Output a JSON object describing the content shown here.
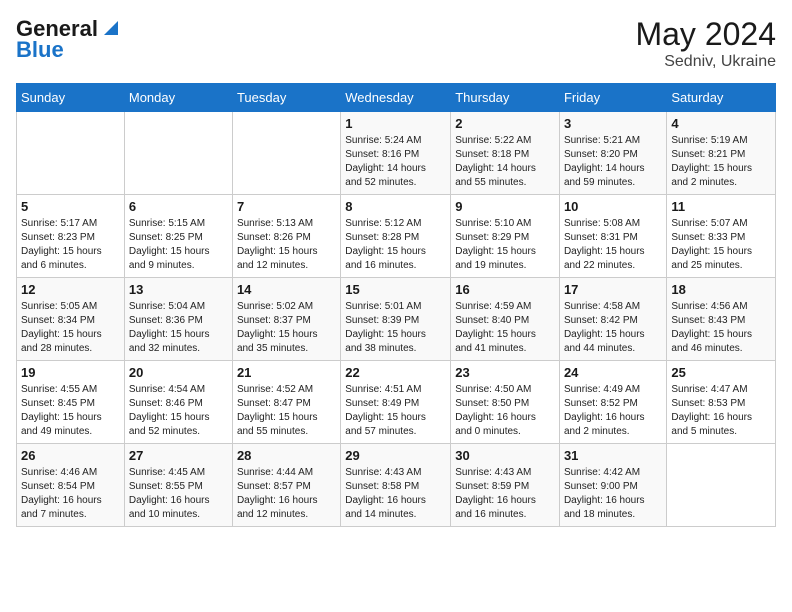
{
  "header": {
    "logo_line1": "General",
    "logo_line2": "Blue",
    "month_year": "May 2024",
    "location": "Sedniv, Ukraine"
  },
  "days_of_week": [
    "Sunday",
    "Monday",
    "Tuesday",
    "Wednesday",
    "Thursday",
    "Friday",
    "Saturday"
  ],
  "weeks": [
    [
      {
        "num": "",
        "info": ""
      },
      {
        "num": "",
        "info": ""
      },
      {
        "num": "",
        "info": ""
      },
      {
        "num": "1",
        "info": "Sunrise: 5:24 AM\nSunset: 8:16 PM\nDaylight: 14 hours\nand 52 minutes."
      },
      {
        "num": "2",
        "info": "Sunrise: 5:22 AM\nSunset: 8:18 PM\nDaylight: 14 hours\nand 55 minutes."
      },
      {
        "num": "3",
        "info": "Sunrise: 5:21 AM\nSunset: 8:20 PM\nDaylight: 14 hours\nand 59 minutes."
      },
      {
        "num": "4",
        "info": "Sunrise: 5:19 AM\nSunset: 8:21 PM\nDaylight: 15 hours\nand 2 minutes."
      }
    ],
    [
      {
        "num": "5",
        "info": "Sunrise: 5:17 AM\nSunset: 8:23 PM\nDaylight: 15 hours\nand 6 minutes."
      },
      {
        "num": "6",
        "info": "Sunrise: 5:15 AM\nSunset: 8:25 PM\nDaylight: 15 hours\nand 9 minutes."
      },
      {
        "num": "7",
        "info": "Sunrise: 5:13 AM\nSunset: 8:26 PM\nDaylight: 15 hours\nand 12 minutes."
      },
      {
        "num": "8",
        "info": "Sunrise: 5:12 AM\nSunset: 8:28 PM\nDaylight: 15 hours\nand 16 minutes."
      },
      {
        "num": "9",
        "info": "Sunrise: 5:10 AM\nSunset: 8:29 PM\nDaylight: 15 hours\nand 19 minutes."
      },
      {
        "num": "10",
        "info": "Sunrise: 5:08 AM\nSunset: 8:31 PM\nDaylight: 15 hours\nand 22 minutes."
      },
      {
        "num": "11",
        "info": "Sunrise: 5:07 AM\nSunset: 8:33 PM\nDaylight: 15 hours\nand 25 minutes."
      }
    ],
    [
      {
        "num": "12",
        "info": "Sunrise: 5:05 AM\nSunset: 8:34 PM\nDaylight: 15 hours\nand 28 minutes."
      },
      {
        "num": "13",
        "info": "Sunrise: 5:04 AM\nSunset: 8:36 PM\nDaylight: 15 hours\nand 32 minutes."
      },
      {
        "num": "14",
        "info": "Sunrise: 5:02 AM\nSunset: 8:37 PM\nDaylight: 15 hours\nand 35 minutes."
      },
      {
        "num": "15",
        "info": "Sunrise: 5:01 AM\nSunset: 8:39 PM\nDaylight: 15 hours\nand 38 minutes."
      },
      {
        "num": "16",
        "info": "Sunrise: 4:59 AM\nSunset: 8:40 PM\nDaylight: 15 hours\nand 41 minutes."
      },
      {
        "num": "17",
        "info": "Sunrise: 4:58 AM\nSunset: 8:42 PM\nDaylight: 15 hours\nand 44 minutes."
      },
      {
        "num": "18",
        "info": "Sunrise: 4:56 AM\nSunset: 8:43 PM\nDaylight: 15 hours\nand 46 minutes."
      }
    ],
    [
      {
        "num": "19",
        "info": "Sunrise: 4:55 AM\nSunset: 8:45 PM\nDaylight: 15 hours\nand 49 minutes."
      },
      {
        "num": "20",
        "info": "Sunrise: 4:54 AM\nSunset: 8:46 PM\nDaylight: 15 hours\nand 52 minutes."
      },
      {
        "num": "21",
        "info": "Sunrise: 4:52 AM\nSunset: 8:47 PM\nDaylight: 15 hours\nand 55 minutes."
      },
      {
        "num": "22",
        "info": "Sunrise: 4:51 AM\nSunset: 8:49 PM\nDaylight: 15 hours\nand 57 minutes."
      },
      {
        "num": "23",
        "info": "Sunrise: 4:50 AM\nSunset: 8:50 PM\nDaylight: 16 hours\nand 0 minutes."
      },
      {
        "num": "24",
        "info": "Sunrise: 4:49 AM\nSunset: 8:52 PM\nDaylight: 16 hours\nand 2 minutes."
      },
      {
        "num": "25",
        "info": "Sunrise: 4:47 AM\nSunset: 8:53 PM\nDaylight: 16 hours\nand 5 minutes."
      }
    ],
    [
      {
        "num": "26",
        "info": "Sunrise: 4:46 AM\nSunset: 8:54 PM\nDaylight: 16 hours\nand 7 minutes."
      },
      {
        "num": "27",
        "info": "Sunrise: 4:45 AM\nSunset: 8:55 PM\nDaylight: 16 hours\nand 10 minutes."
      },
      {
        "num": "28",
        "info": "Sunrise: 4:44 AM\nSunset: 8:57 PM\nDaylight: 16 hours\nand 12 minutes."
      },
      {
        "num": "29",
        "info": "Sunrise: 4:43 AM\nSunset: 8:58 PM\nDaylight: 16 hours\nand 14 minutes."
      },
      {
        "num": "30",
        "info": "Sunrise: 4:43 AM\nSunset: 8:59 PM\nDaylight: 16 hours\nand 16 minutes."
      },
      {
        "num": "31",
        "info": "Sunrise: 4:42 AM\nSunset: 9:00 PM\nDaylight: 16 hours\nand 18 minutes."
      },
      {
        "num": "",
        "info": ""
      }
    ]
  ]
}
